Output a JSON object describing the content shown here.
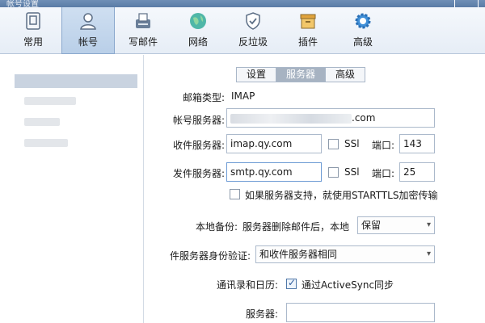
{
  "window": {
    "title": "帐号设置"
  },
  "toolbar": {
    "items": [
      {
        "label": "常用",
        "icon": "general-icon"
      },
      {
        "label": "帐号",
        "icon": "user-icon"
      },
      {
        "label": "写邮件",
        "icon": "compose-icon"
      },
      {
        "label": "网络",
        "icon": "globe-icon"
      },
      {
        "label": "反垃圾",
        "icon": "shield-icon"
      },
      {
        "label": "插件",
        "icon": "plugin-icon"
      },
      {
        "label": "高级",
        "icon": "gear-icon"
      }
    ],
    "active_index": 1
  },
  "tabs": [
    {
      "label": "设置"
    },
    {
      "label": "服务器"
    },
    {
      "label": "高级"
    }
  ],
  "form": {
    "mail_type_label": "邮箱类型:",
    "mail_type_value": "IMAP",
    "account_server_label": "帐号服务器:",
    "account_server_value_suffix": ".com",
    "incoming_server_label": "收件服务器:",
    "incoming_server_value": "imap.qy.com",
    "incoming_ssl_label": "SSl",
    "incoming_port_label": "端口:",
    "incoming_port_value": "143",
    "outgoing_server_label": "发件服务器:",
    "outgoing_server_value": "smtp.qy.com",
    "outgoing_ssl_label": "SSl",
    "outgoing_port_label": "端口:",
    "outgoing_port_value": "25",
    "starttls_label": "如果服务器支持，就使用STARTTLS加密传输",
    "local_backup_label": "本地备份:",
    "local_backup_text": "服务器删除邮件后，本地",
    "local_backup_select": "保留",
    "auth_label": "件服务器身份验证:",
    "auth_select": "和收件服务器相同",
    "contacts_label": "通讯录和日历:",
    "activesync_label": "通过ActiveSync同步",
    "activesync_checked": true,
    "server_label": "服务器:",
    "server_value": ""
  },
  "colors": {
    "accent": "#2b5a9a",
    "toolbar_active": "#b9cfe8",
    "selection": "#c9d3e0"
  }
}
